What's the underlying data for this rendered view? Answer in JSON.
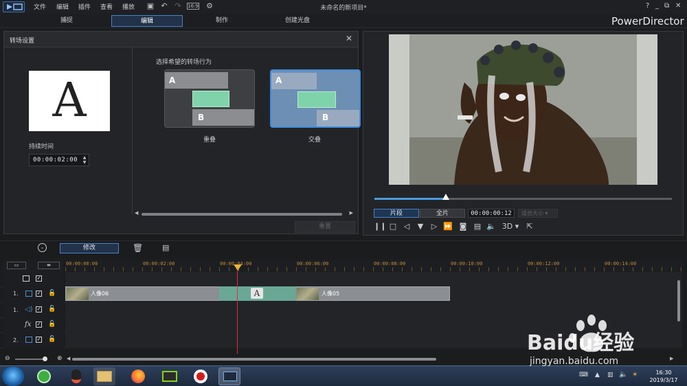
{
  "app": {
    "menu": [
      "文件",
      "编辑",
      "插件",
      "查看",
      "播放"
    ],
    "window_title": "未命名的新项目*",
    "brand": "PowerDirector",
    "win_controls": [
      "?",
      "_",
      "⧉",
      "✕"
    ]
  },
  "modes": {
    "tabs": [
      {
        "label": "捕捉",
        "active": false
      },
      {
        "label": "编辑",
        "active": true
      },
      {
        "label": "制作",
        "active": false
      },
      {
        "label": "创建光盘",
        "active": false
      }
    ]
  },
  "transition_panel": {
    "title": "转场设置",
    "preview_letter": "A",
    "duration_label": "持续时间",
    "duration_value": "00:00:02:00",
    "choose_label": "选择希望的转场行为",
    "options": [
      {
        "label": "重叠",
        "selected": false,
        "a": "A",
        "b": "B"
      },
      {
        "label": "交叠",
        "selected": true,
        "a": "A",
        "b": "B"
      }
    ],
    "apply_label": "重置"
  },
  "viewer": {
    "clip_label": "片段",
    "full_label": "全片",
    "timecode": "00:00:00:12",
    "fit_label": "适合大小",
    "three_d_label": "3D",
    "seek_progress": 0.24
  },
  "timeline": {
    "modify_label": "修改",
    "ruler_marks": [
      "00:00:00:00",
      "00:00:02:00",
      "00:00:04:00",
      "00:00:06:00",
      "00:00:08:00",
      "00:00:10:00",
      "00:00:12:00",
      "00:00:14:00"
    ],
    "tracks": [
      {
        "number": "",
        "type": "master"
      },
      {
        "number": "1.",
        "type": "video",
        "clips": [
          {
            "name": "人像06"
          },
          {
            "name": "人像05"
          }
        ],
        "transition_letter": "A"
      },
      {
        "number": "1.",
        "type": "audio"
      },
      {
        "number": "",
        "type": "fx",
        "label": "fx"
      },
      {
        "number": "2.",
        "type": "video"
      }
    ]
  },
  "taskbar": {
    "time": "16:30",
    "date": "2019/3/17"
  },
  "watermark": {
    "brand": "Baidu经验",
    "url": "jingyan.baidu.com"
  },
  "colors": {
    "accent": "#4b82c7",
    "transition": "#6aa895",
    "playhead": "#d23232",
    "ruler_text": "#c08a3c"
  }
}
